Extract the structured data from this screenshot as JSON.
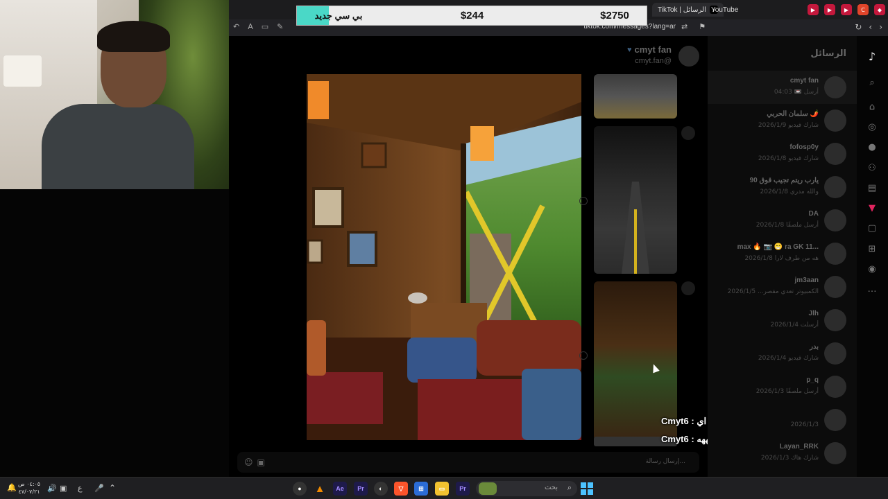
{
  "browser": {
    "tabs": [
      {
        "label": "YouTube"
      },
      {
        "label": "TikTok | الرسائل"
      }
    ],
    "url": "tiktok.com/messages?lang=ar"
  },
  "banner": {
    "label": "بي سي جديد",
    "current": "$244",
    "goal": "$2750",
    "progress_fraction": 0.09
  },
  "chat": {
    "header_name": "cmyt fan",
    "header_handle": "cmyt.fan@",
    "input_placeholder": "إرسال رسالة..."
  },
  "sidebar": {
    "title": "الرسائل",
    "conversations": [
      {
        "name": "cmyt fan",
        "sub": "أرسل 📼 04:03",
        "active": true
      },
      {
        "name": "سلمان الحربي 🌶️",
        "sub": "شارك فيديو 2026/1/9"
      },
      {
        "name": "fofosp0y",
        "sub": "شارك فيديو 2026/1/8"
      },
      {
        "name": "يارب ريتم تجيب قوق 90",
        "sub": "والله مدري 2026/1/8"
      },
      {
        "name": "DA",
        "sub": "أرسل ملصقًا 2026/1/8"
      },
      {
        "name": "max 🔥 📷 😁 ra GK 11...",
        "sub": "هه من طرف لارا 2026/1/8"
      },
      {
        "name": "jm3aan",
        "sub": "الكمبيوتر تعدي مقصر... 2026/1/5"
      },
      {
        "name": "Jlh",
        "sub": "أرسلت 2026/1/4"
      },
      {
        "name": "بدر",
        "sub": "شارك فيديو 2026/1/4"
      },
      {
        "name": "p_q",
        "sub": "أرسل ملصقًا 2026/1/3"
      },
      {
        "name": "",
        "sub": "2026/1/3"
      },
      {
        "name": "Layan_RRK",
        "sub": "شارك هاك 2026/1/3"
      }
    ]
  },
  "overlay_chat": [
    {
      "user": "Cmyt6",
      "msg": "اي"
    },
    {
      "user": "Cmyt6",
      "msg": "هههههه"
    }
  ],
  "taskbar": {
    "search_placeholder": "بحث",
    "time": "٠٤:٠٥ ص",
    "date": "٤٧/٠٧/٢١",
    "lang": "ع"
  },
  "colors": {
    "banner_progress": "#4ad8c7",
    "banner_bg": "#ececec",
    "page_bg": "#000000"
  },
  "icons": {
    "sidebar_nav": [
      "tiktok-logo-icon",
      "search-icon",
      "home-icon",
      "explore-icon",
      "following-icon",
      "friends-icon",
      "live-icon",
      "activity-icon",
      "messages-icon",
      "upload-icon",
      "profile-icon",
      "more-icon"
    ]
  }
}
